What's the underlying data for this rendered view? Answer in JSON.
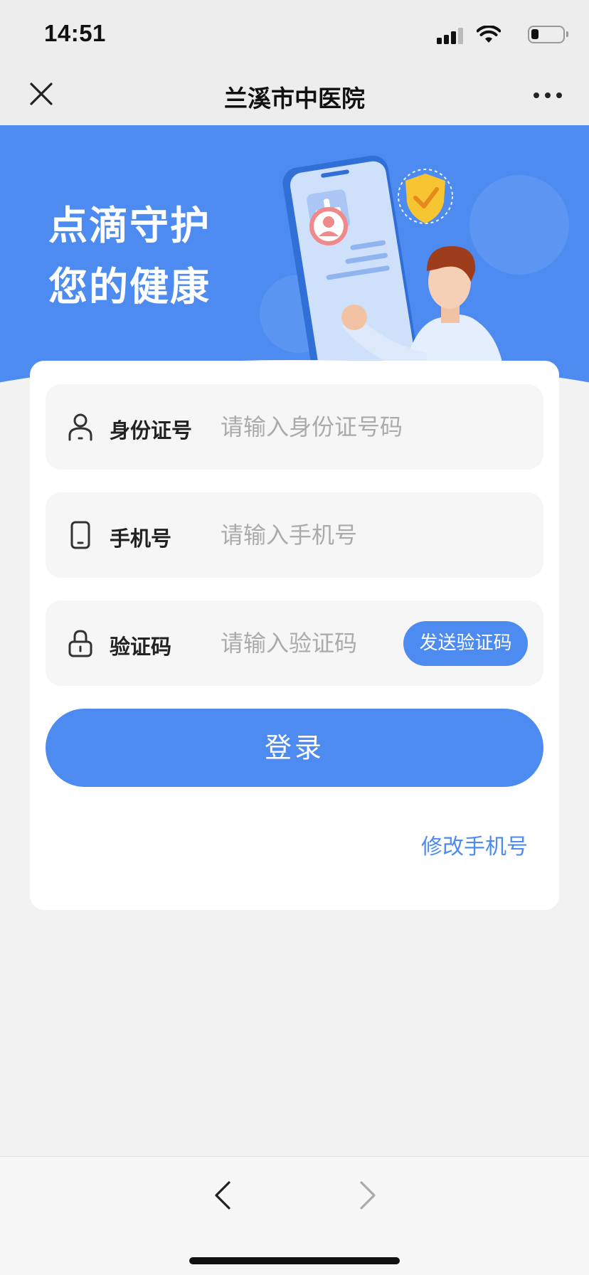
{
  "status_bar": {
    "time": "14:51",
    "icons": [
      "signal-icon",
      "wifi-icon",
      "battery-icon"
    ]
  },
  "nav": {
    "title": "兰溪市中医院",
    "close_icon": "close-icon",
    "more_icon": "more-icon"
  },
  "banner": {
    "line1": "点滴守护",
    "line2": "您的健康",
    "background_color": "#4d8bf0"
  },
  "form": {
    "id_field": {
      "label": "身份证号",
      "placeholder": "请输入身份证号码",
      "value": "",
      "icon": "user-icon"
    },
    "phone_field": {
      "label": "手机号",
      "placeholder": "请输入手机号",
      "value": "",
      "icon": "phone-icon"
    },
    "code_field": {
      "label": "验证码",
      "placeholder": "请输入验证码",
      "value": "",
      "icon": "lock-icon",
      "send_label": "发送验证码"
    },
    "login_label": "登录",
    "change_phone_label": "修改手机号",
    "accent_color": "#4d8bf0"
  },
  "toolbar": {
    "back_icon": "chevron-left-icon",
    "forward_icon": "chevron-right-icon"
  }
}
